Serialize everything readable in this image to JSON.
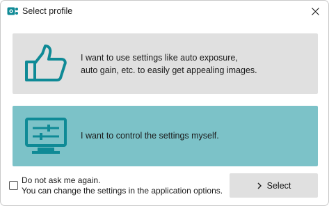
{
  "window": {
    "title": "Select profile",
    "app_icon": "camera-gear-icon",
    "close_icon": "close-icon"
  },
  "options": [
    {
      "icon": "thumbs-up-icon",
      "line1": "I want to use settings like auto exposure,",
      "line2": "auto gain, etc. to easily get appealing images.",
      "selected": false
    },
    {
      "icon": "monitor-sliders-icon",
      "line1": "I want to control the settings myself.",
      "selected": true
    }
  ],
  "footer": {
    "checkbox_checked": false,
    "line1": "Do not ask me again.",
    "line2": "You can change the settings in the application options.",
    "select_label": "Select",
    "select_icon": "chevron-right-icon"
  },
  "colors": {
    "accent": "#0f8a96",
    "selected_card": "#7cc2c8",
    "unselected_card": "#e0e0e0",
    "button": "#e0e0e0"
  }
}
